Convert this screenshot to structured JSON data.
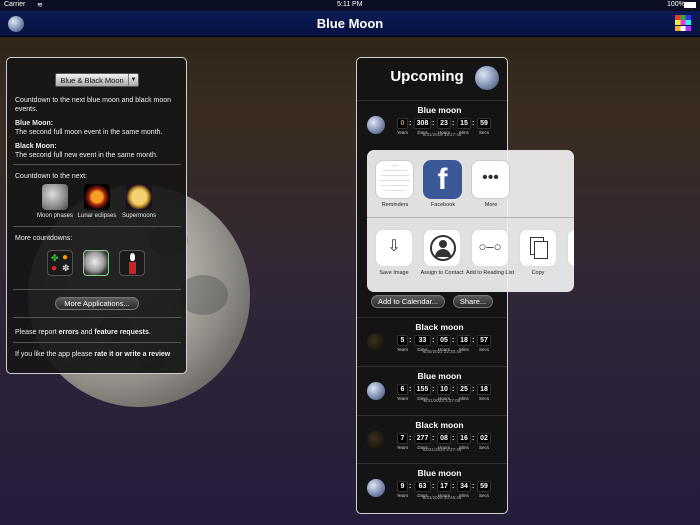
{
  "status": {
    "carrier": "Carrier",
    "time": "5:11 PM",
    "battery": "100%"
  },
  "nav": {
    "title": "Blue Moon"
  },
  "left": {
    "dropdown": "Blue & Black Moon",
    "intro": "Countdown to the next blue moon and black moon events.",
    "blue_title": "Blue Moon:",
    "blue_desc": "The second full moon event in the same month.",
    "black_title": "Black Moon:",
    "black_desc": "The second full new event in the same month.",
    "countdown_label": "Countdown to the next:",
    "apps": [
      "Moon phases",
      "Lunar eclipses",
      "Supermoons"
    ],
    "more_label": "More countdowns:",
    "more_apps": "More Applications...",
    "report_pre": "Please report ",
    "report_errors": "errors",
    "report_and": " and ",
    "report_feat": "feature requests",
    "report_end": ".",
    "rate_pre": "If you like the app please ",
    "rate_link": "rate it or write a review"
  },
  "upcoming": {
    "title": "Upcoming",
    "unit_labels": [
      "Years",
      "Days",
      "Hours",
      "Mins",
      "Secs"
    ],
    "events": [
      {
        "name": "Blue moon",
        "years": "0",
        "days": "308",
        "hours": "23",
        "mins": "15",
        "secs": "59",
        "date": "1/31/2018 15:27:48",
        "kind": "blue"
      },
      {
        "name": "Black moon",
        "years": "5",
        "days": "33",
        "hours": "05",
        "mins": "18",
        "secs": "57",
        "date": "4/30/2022 22:30:44",
        "kind": "black"
      },
      {
        "name": "Blue moon",
        "years": "6",
        "days": "155",
        "hours": "10",
        "mins": "25",
        "secs": "18",
        "date": "8/31/2023 3:37:05",
        "kind": "blue"
      },
      {
        "name": "Black moon",
        "years": "7",
        "days": "277",
        "hours": "08",
        "mins": "16",
        "secs": "02",
        "date": "12/31/2024 2:27:49",
        "kind": "black"
      },
      {
        "name": "Blue moon",
        "years": "9",
        "days": "63",
        "hours": "17",
        "mins": "34",
        "secs": "59",
        "date": "5/31/2026 10:46:46",
        "kind": "blue"
      }
    ],
    "add_calendar": "Add to Calendar...",
    "share": "Share..."
  },
  "share_sheet": {
    "apps": [
      "Reminders",
      "Facebook",
      "More"
    ],
    "actions": [
      "Save Image",
      "Assign to Contact",
      "Add to Reading List",
      "Copy"
    ]
  }
}
